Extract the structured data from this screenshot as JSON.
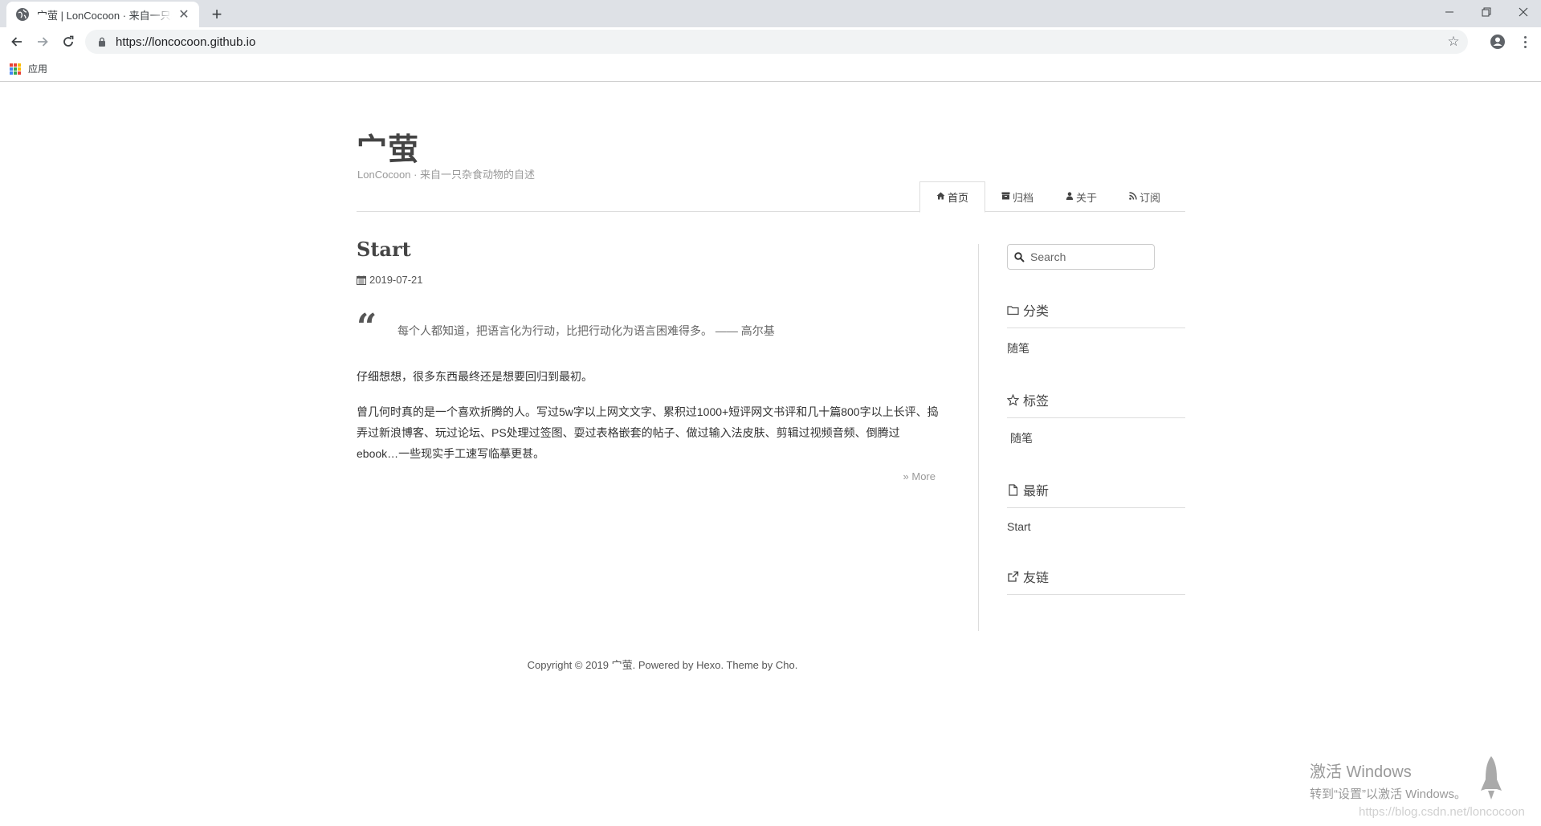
{
  "browser": {
    "tab_title": "宀萤 | LonCocoon · 来自一只杂食动物的自述",
    "url": "https://loncocoon.github.io",
    "bookmarks_apps_label": "应用",
    "new_tab_symbol": "+",
    "close_symbol": "✕"
  },
  "site": {
    "title": "宀萤",
    "subtitle": "LonCocoon · 来自一只杂食动物的自述",
    "nav": [
      {
        "icon": "home-icon",
        "label": "首页",
        "active": true
      },
      {
        "icon": "archive-icon",
        "label": "归档"
      },
      {
        "icon": "user-icon",
        "label": "关于"
      },
      {
        "icon": "rss-icon",
        "label": "订阅"
      }
    ]
  },
  "post": {
    "title": "Start",
    "date": "2019-07-21",
    "quote_mark": "“",
    "quote": "每个人都知道，把语言化为行动，比把行动化为语言困难得多。 —— 高尔基",
    "paragraph1": "仔细想想，很多东西最终还是想要回归到最初。",
    "paragraph2": "曾几何时真的是一个喜欢折腾的人。写过5w字以上网文文字、累积过1000+短评网文书评和几十篇800字以上长评、捣弄过新浪博客、玩过论坛、PS处理过签图、耍过表格嵌套的帖子、做过输入法皮肤、剪辑过视频音频、倒腾过ebook…一些现实手工速写临摹更甚。",
    "more": "» More"
  },
  "sidebar": {
    "search_placeholder": "Search",
    "categories_title": "分类",
    "categories": [
      "随笔"
    ],
    "tags_title": "标签",
    "tags": [
      "随笔"
    ],
    "recent_title": "最新",
    "recent": [
      "Start"
    ],
    "links_title": "友链"
  },
  "footer": {
    "text": "Copyright © 2019 宀萤. Powered by Hexo. Theme by Cho."
  },
  "overlay": {
    "activate_title": "激活 Windows",
    "activate_sub": "转到“设置”以激活 Windows。",
    "watermark": "https://blog.csdn.net/loncocoon"
  }
}
